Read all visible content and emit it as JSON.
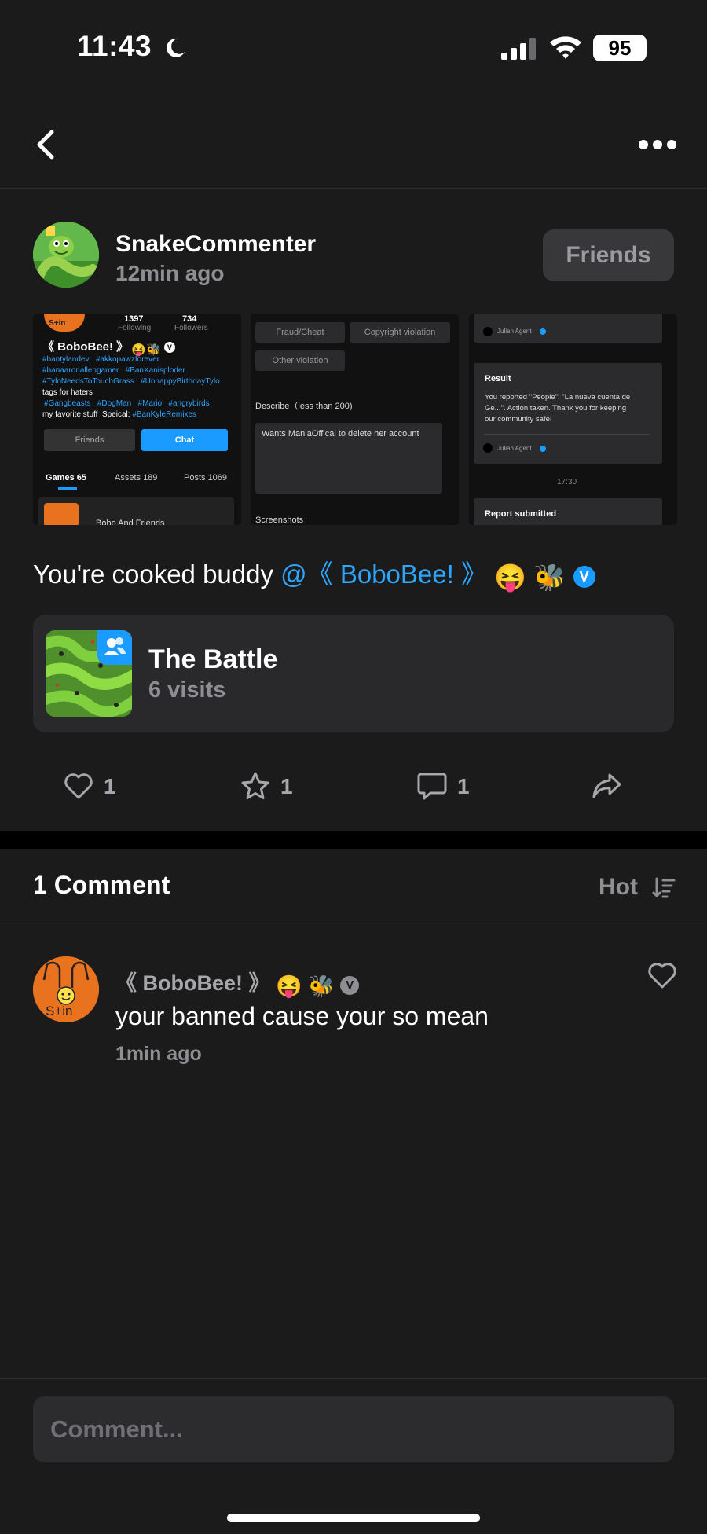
{
  "status": {
    "time": "11:43",
    "battery": "95"
  },
  "post": {
    "author": "SnakeCommenter",
    "time": "12min ago",
    "friends_label": "Friends",
    "caption_text": "You're cooked buddy",
    "mention": "@《 BoboBee! 》",
    "game": {
      "title": "The Battle",
      "visits": "6 visits"
    },
    "actions": {
      "likes": "1",
      "favorites": "1",
      "comments": "1"
    }
  },
  "screenshots": {
    "s1": {
      "following_count": "1397",
      "following_label": "Following",
      "followers_count": "734",
      "followers_label": "Followers",
      "name": "《 BoboBee! 》",
      "tags1": "#bantylandev   #akkopawzforever",
      "tags2": "#banaaronallengamer   #BanXanisploder",
      "tags3": "#TyloNeedsToTouchGrass   #UnhappyBirthdayTylo",
      "line4": "tags for haters",
      "tags5": "#Gangbeasts   #DogMan   #Mario   #angrybirds",
      "line6_prefix": "my favorite stuff  Speical: ",
      "line6_tag": "#BanKyleRemixes",
      "friends_btn": "Friends",
      "chat_btn": "Chat",
      "tab_games": "Games 65",
      "tab_assets": "Assets 189",
      "tab_posts": "Posts 1069",
      "item": "Bobo And Friends",
      "avatar_text": "S+in"
    },
    "s2": {
      "opt1": "Fraud/Cheat",
      "opt2": "Copyright violation",
      "opt3": "Other violation",
      "describe_label": "Describe（less than 200)",
      "describe_value": "Wants ManiaOffical to delete her account",
      "screenshots_label": "Screenshots"
    },
    "s3": {
      "agent": "Julian Agent",
      "result_title": "Result",
      "result_text1": "You reported \"People\": \"La nueva cuenta de",
      "result_text2": "Ge...\". Action taken. Thank you for keeping",
      "result_text3": "our community safe!",
      "agent2": "Julian Agent",
      "time": "17:30",
      "submitted": "Report submitted"
    }
  },
  "comments": {
    "title": "1 Comment",
    "sort_label": "Hot",
    "items": [
      {
        "name": "《 BoboBee! 》",
        "text": "your banned cause your so mean",
        "time": "1min ago",
        "avatar_text": "S+in"
      }
    ]
  },
  "input": {
    "placeholder": "Comment..."
  },
  "colors": {
    "accent": "#2ca6ff",
    "background": "#1b1b1c",
    "card": "#29292c"
  }
}
